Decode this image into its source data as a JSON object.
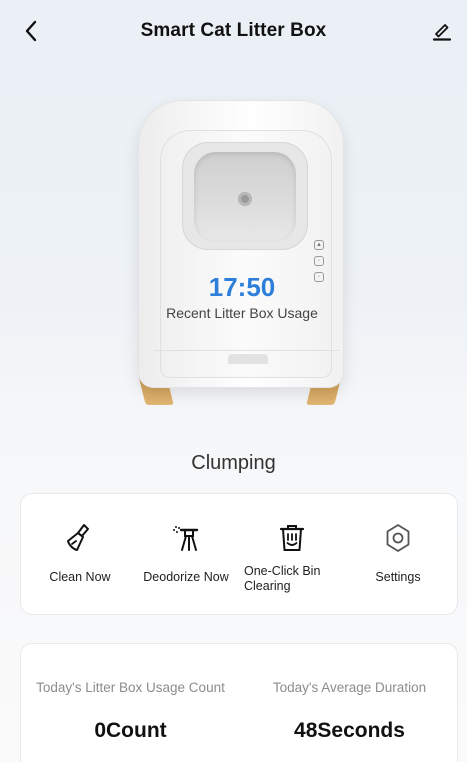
{
  "header": {
    "title": "Smart Cat Litter Box",
    "back_icon": "chevron-left-icon",
    "edit_icon": "pencil-icon"
  },
  "device": {
    "time": "17:50",
    "caption": "Recent Litter Box Usage",
    "accent_color": "#2d7fd9"
  },
  "status": "Clumping",
  "actions": [
    {
      "label": "Clean Now",
      "icon": "broom-icon"
    },
    {
      "label": "Deodorize Now",
      "icon": "spray-icon"
    },
    {
      "label": "One-Click Bin Clearing",
      "icon": "trash-bin-icon"
    },
    {
      "label": "Settings",
      "icon": "gear-icon"
    }
  ],
  "stats": {
    "usage_count_label": "Today's Litter Box Usage Count",
    "usage_count_value": "0Count",
    "avg_duration_label": "Today's Average Duration",
    "avg_duration_value": "48Seconds"
  }
}
